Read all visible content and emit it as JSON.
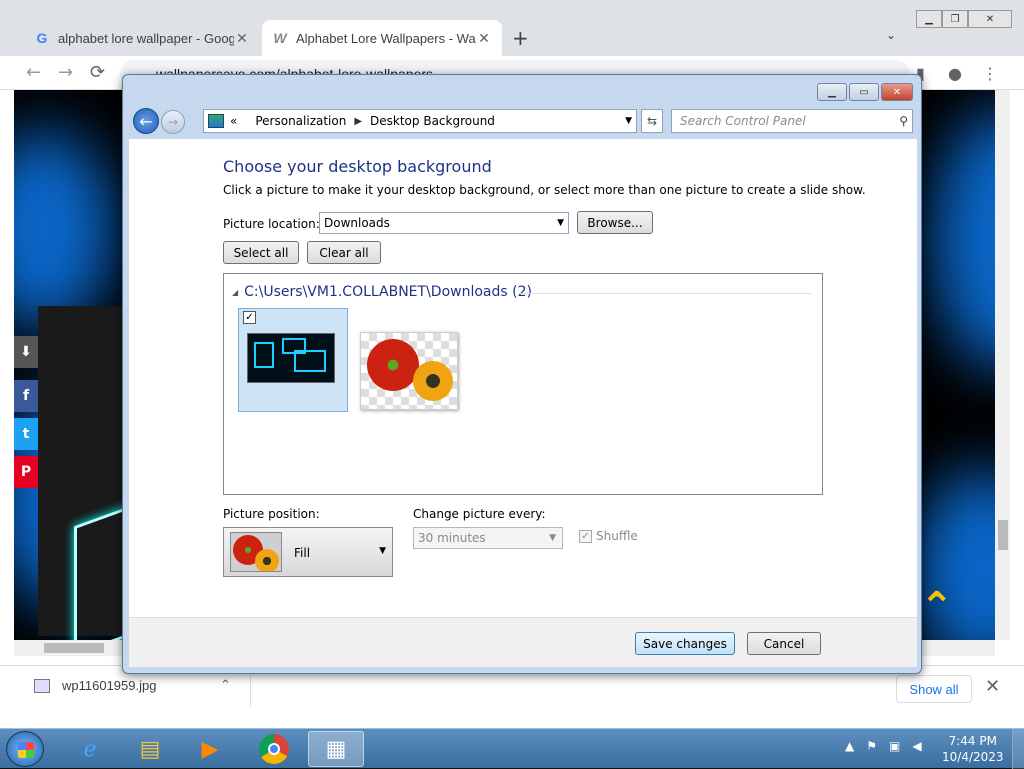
{
  "browser": {
    "tabs": [
      {
        "favicon": "G",
        "title": "alphabet lore wallpaper - Google",
        "close": "✕"
      },
      {
        "favicon": "W",
        "title": "Alphabet Lore Wallpapers - Wall",
        "close": "✕"
      }
    ],
    "new_tab": "+",
    "tab_search": "⌄",
    "url": "wallpapercave.com/alphabet-lore-wallpapers",
    "nav": {
      "back": "←",
      "forward": "→",
      "reload": "⟳"
    }
  },
  "download_bar": {
    "filename": "wp11601959.jpg",
    "chevron": "⌃",
    "show_all": "Show all",
    "close": "✕"
  },
  "cp_window": {
    "breadcrumb": [
      "Personalization",
      "Desktop Background"
    ],
    "breadcrumb_prefix": "«",
    "search_placeholder": "Search Control Panel",
    "title": "Choose your desktop background",
    "description": "Click a picture to make it your desktop background, or select more than one picture to create a slide show.",
    "picture_location_label": "Picture location:",
    "picture_location_value": "Downloads",
    "browse_label": "Browse...",
    "select_all_label": "Select all",
    "clear_all_label": "Clear all",
    "folder_header": "C:\\Users\\VM1.COLLABNET\\Downloads (2)",
    "picture_position_label": "Picture position:",
    "picture_position_value": "Fill",
    "change_every_label": "Change picture every:",
    "change_every_value": "30 minutes",
    "shuffle_label": "Shuffle",
    "save_label": "Save changes",
    "cancel_label": "Cancel"
  },
  "taskbar": {
    "time": "7:44 PM",
    "date": "10/4/2023"
  },
  "colors": {
    "title_blue": "#1e3287",
    "accent_yellow": "#f5c400"
  }
}
